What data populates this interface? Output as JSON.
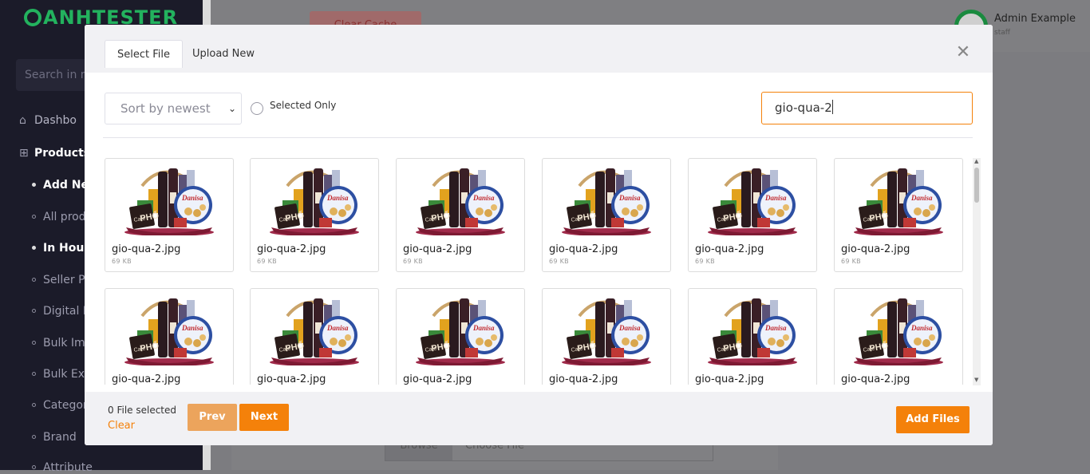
{
  "app": {
    "logo": "ANHTESTER"
  },
  "sidebar": {
    "search_placeholder": "Search in m",
    "items": [
      {
        "label": "Dashbo",
        "type": "top"
      },
      {
        "label": "Products",
        "type": "top"
      },
      {
        "label": "Add Nev",
        "type": "sub",
        "active": true
      },
      {
        "label": "All produ",
        "type": "sub"
      },
      {
        "label": "In House",
        "type": "sub",
        "active": true
      },
      {
        "label": "Seller Pro",
        "type": "sub"
      },
      {
        "label": "Digital P",
        "type": "sub"
      },
      {
        "label": "Bulk Imp",
        "type": "sub"
      },
      {
        "label": "Bulk Exp",
        "type": "sub"
      },
      {
        "label": "Categor",
        "type": "sub"
      },
      {
        "label": "Brand",
        "type": "sub"
      },
      {
        "label": "Attribute",
        "type": "sub"
      }
    ]
  },
  "header": {
    "user_name": "Admin Example",
    "user_role": "staff",
    "clear_cache": "Clear Cache"
  },
  "background_form": {
    "browse": "Browse",
    "choose_file": "Choose File"
  },
  "modal": {
    "tabs": [
      {
        "label": "Select File",
        "active": true
      },
      {
        "label": "Upload New",
        "active": false
      }
    ],
    "sort_select": {
      "value": "Sort by newest"
    },
    "selected_only_label": "Selected Only",
    "search_value": "gio-qua-2",
    "files": [
      {
        "name": "gio-qua-2.jpg",
        "size": "69 KB"
      },
      {
        "name": "gio-qua-2.jpg",
        "size": "69 KB"
      },
      {
        "name": "gio-qua-2.jpg",
        "size": "69 KB"
      },
      {
        "name": "gio-qua-2.jpg",
        "size": "69 KB"
      },
      {
        "name": "gio-qua-2.jpg",
        "size": "69 KB"
      },
      {
        "name": "gio-qua-2.jpg",
        "size": "69 KB"
      },
      {
        "name": "gio-qua-2.jpg",
        "size": ""
      },
      {
        "name": "gio-qua-2.jpg",
        "size": ""
      },
      {
        "name": "gio-qua-2.jpg",
        "size": ""
      },
      {
        "name": "gio-qua-2.jpg",
        "size": ""
      },
      {
        "name": "gio-qua-2.jpg",
        "size": ""
      },
      {
        "name": "gio-qua-2.jpg",
        "size": ""
      }
    ],
    "footer": {
      "selected_count": "0 File selected",
      "clear_label": "Clear",
      "prev_label": "Prev",
      "next_label": "Next",
      "add_files_label": "Add Files"
    }
  },
  "colors": {
    "accent": "#f4810a",
    "sidebar_bg": "#1b1b29",
    "logo": "#23b25e"
  }
}
